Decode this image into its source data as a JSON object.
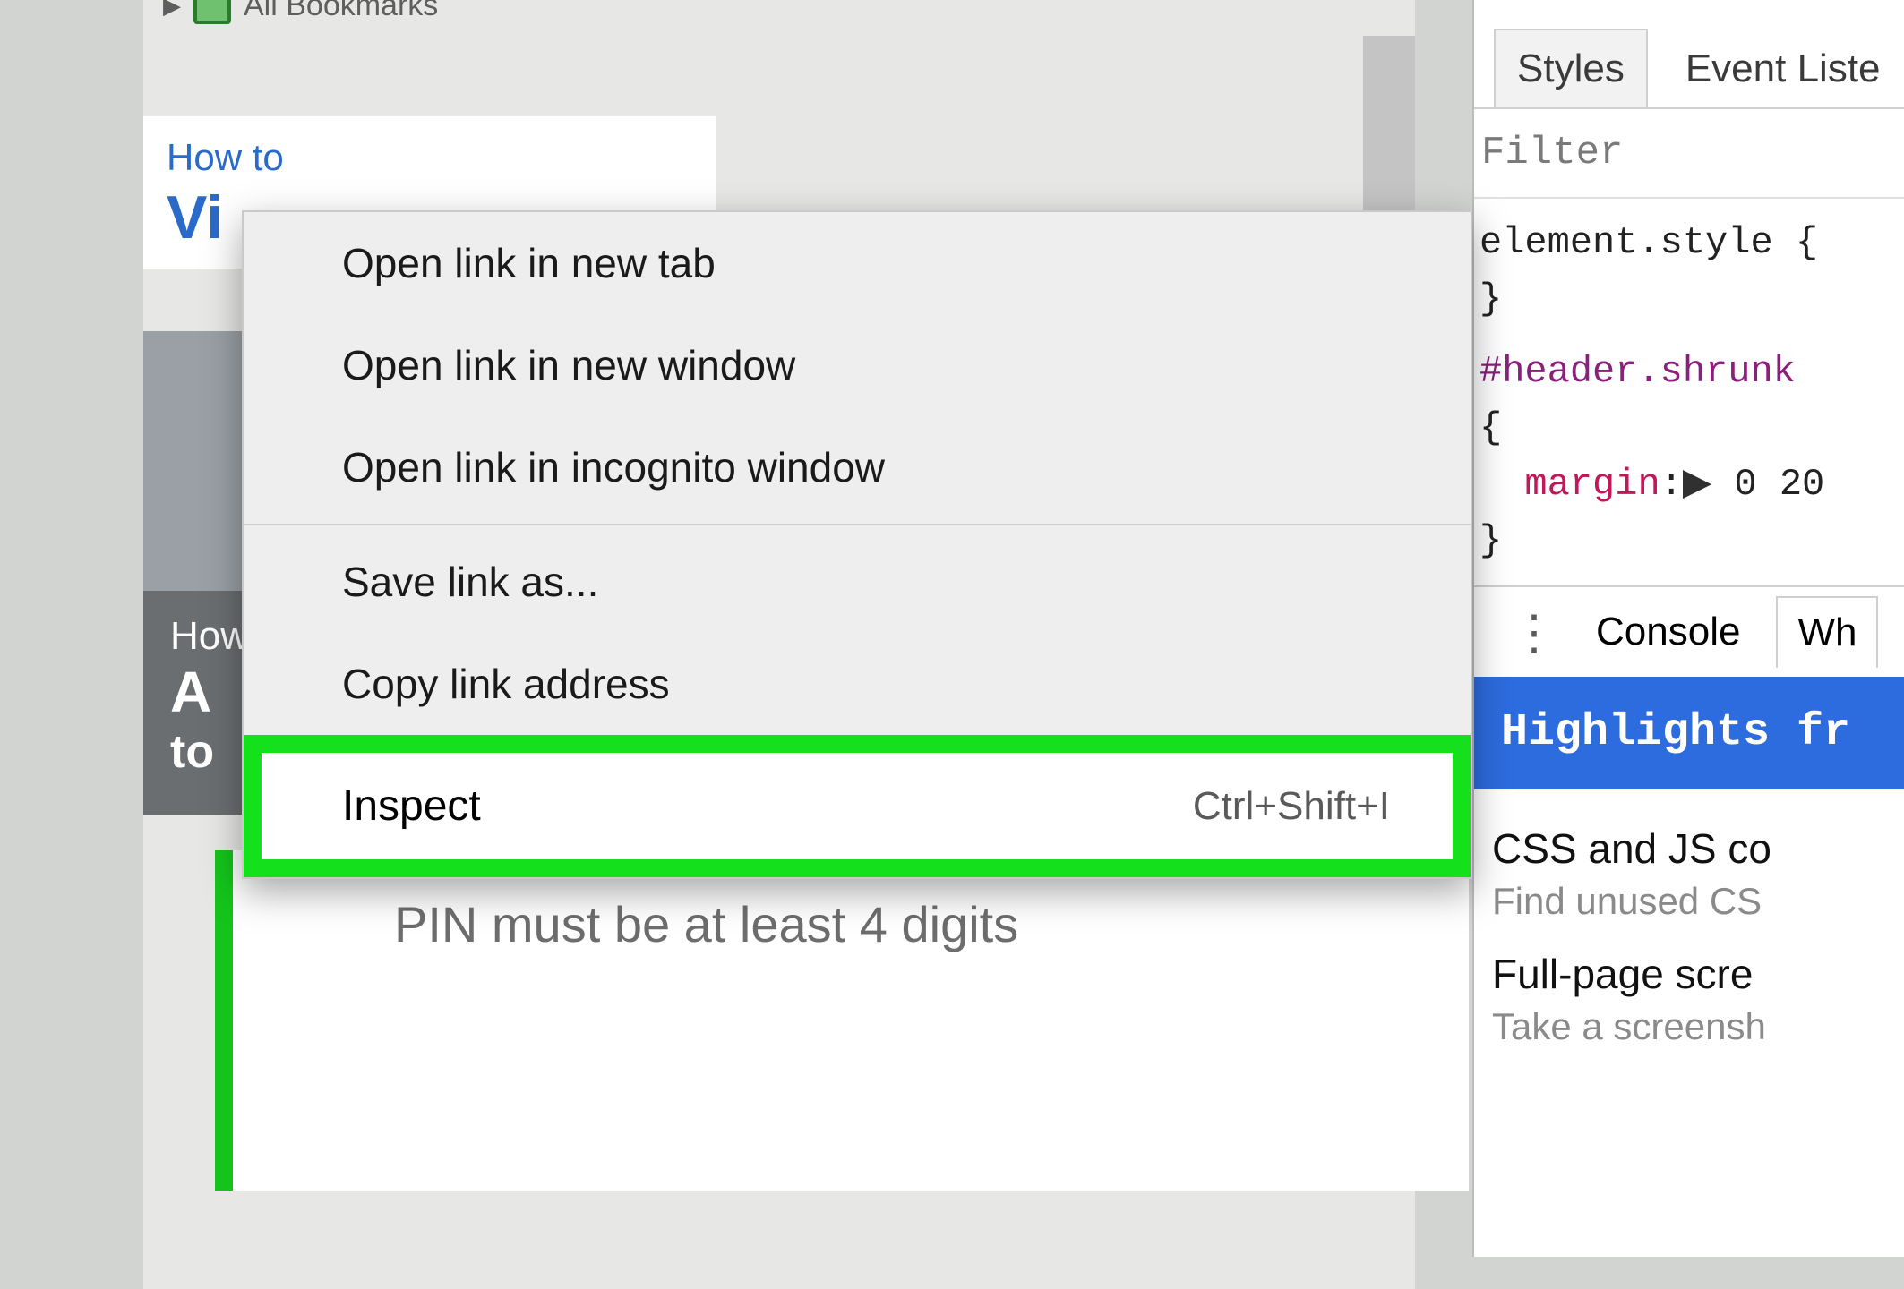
{
  "bookmarks": {
    "all_label": "All Bookmarks"
  },
  "article_card": {
    "eyebrow": "How to",
    "title_fragment": "Vi"
  },
  "thumb_overlay": {
    "line1": "How",
    "line2": "A",
    "line3": "to"
  },
  "pin_hint": "PIN must be at least 4 digits",
  "context_menu": {
    "items": [
      "Open link in new tab",
      "Open link in new window",
      "Open link in incognito window"
    ],
    "group2": [
      "Save link as...",
      "Copy link address"
    ],
    "highlight": {
      "label": "Inspect",
      "shortcut": "Ctrl+Shift+I"
    }
  },
  "devtools": {
    "tabs": {
      "styles": "Styles",
      "event": "Event Liste"
    },
    "filter_placeholder": "Filter",
    "css": {
      "line1": "element.style {",
      "line2": "}",
      "selector": "#header.shrunk",
      "open": "{",
      "prop": "margin",
      "val": "0  20",
      "close": "}"
    },
    "drawer": {
      "console": "Console",
      "other": "Wh"
    },
    "highlights_banner": "Highlights fr",
    "coverage": {
      "h1": "CSS and JS co",
      "s1": "Find unused CS",
      "h2": "Full-page scre",
      "s2": "Take a screensh"
    }
  }
}
